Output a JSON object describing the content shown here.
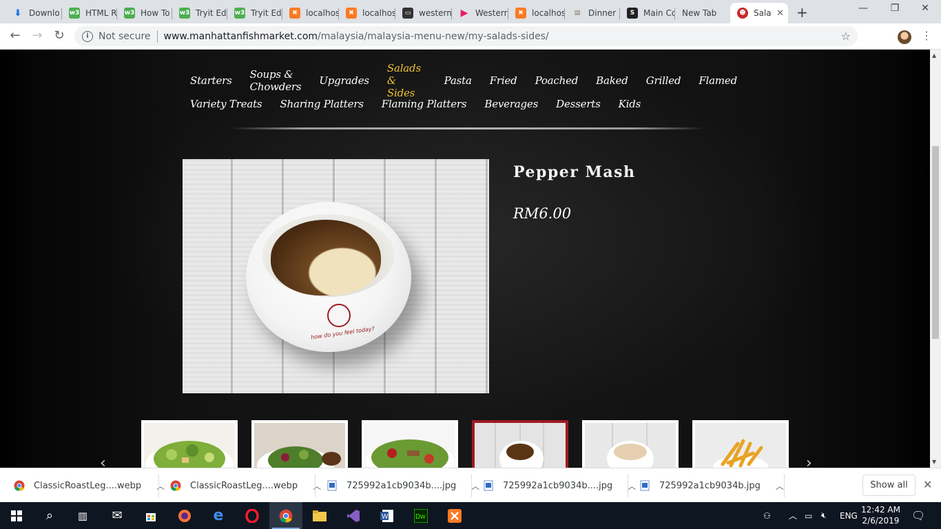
{
  "browser": {
    "tabs": [
      {
        "title": "Downlo",
        "icon": "download-icon",
        "color": "#1a73e8"
      },
      {
        "title": "HTML R",
        "icon": "w3schools-icon",
        "color": "#4caf50"
      },
      {
        "title": "How To",
        "icon": "w3schools-icon",
        "color": "#4caf50"
      },
      {
        "title": "Tryit Ed",
        "icon": "w3schools-icon",
        "color": "#4caf50"
      },
      {
        "title": "Tryit Ed",
        "icon": "w3schools-icon",
        "color": "#4caf50"
      },
      {
        "title": "localhos",
        "icon": "xampp-icon",
        "color": "#fb7a24"
      },
      {
        "title": "localhos",
        "icon": "xampp-icon",
        "color": "#fb7a24"
      },
      {
        "title": "western",
        "icon": "site-icon",
        "color": "#333333"
      },
      {
        "title": "Westerr",
        "icon": "play-icon",
        "color": "#e91e63"
      },
      {
        "title": "localhos",
        "icon": "xampp-icon",
        "color": "#fb7a24"
      },
      {
        "title": "Dinner",
        "icon": "page-icon",
        "color": "#9e9e9e"
      },
      {
        "title": "Main Co",
        "icon": "s-icon",
        "color": "#222222"
      },
      {
        "title": "New Tab",
        "icon": "",
        "color": ""
      },
      {
        "title": "Sala",
        "icon": "manhattan-icon",
        "color": "#c62828",
        "active": true
      }
    ],
    "security_label": "Not secure",
    "url_host": "www.manhattanfishmarket.com",
    "url_path": "/malaysia/malaysia-menu-new/my-salads-sides/"
  },
  "menu": {
    "row1": [
      "Starters",
      "Soups & Chowders",
      "Upgrades",
      "Salads & Sides",
      "Pasta",
      "Fried",
      "Poached",
      "Baked",
      "Grilled",
      "Flamed"
    ],
    "row2": [
      "Variety Treats",
      "Sharing Platters",
      "Flaming Platters",
      "Beverages",
      "Desserts",
      "Kids"
    ],
    "active": "Salads & Sides",
    "active_color": "#f2c230"
  },
  "product": {
    "name": "Pepper Mash",
    "price": "RM6.00",
    "bowl_text": "how do you feel today?"
  },
  "thumbnails": [
    {
      "name": "caesar-salad",
      "current": false
    },
    {
      "name": "garden-salad",
      "current": false
    },
    {
      "name": "grilled-salad",
      "current": false
    },
    {
      "name": "pepper-mash",
      "current": true
    },
    {
      "name": "rice",
      "current": false
    },
    {
      "name": "fries",
      "current": false
    }
  ],
  "downloads": [
    {
      "file": "ClassicRoastLeg....webp",
      "icon": "chrome-icon"
    },
    {
      "file": "ClassicRoastLeg....webp",
      "icon": "chrome-icon"
    },
    {
      "file": "725992a1cb9034b....jpg",
      "icon": "image-file-icon"
    },
    {
      "file": "725992a1cb9034b....jpg",
      "icon": "image-file-icon"
    },
    {
      "file": "725992a1cb9034b.jpg",
      "icon": "image-file-icon"
    }
  ],
  "shelf": {
    "show_all": "Show all"
  },
  "taskbar": {
    "language": "ENG",
    "time": "12:42 AM",
    "date": "2/6/2019"
  }
}
